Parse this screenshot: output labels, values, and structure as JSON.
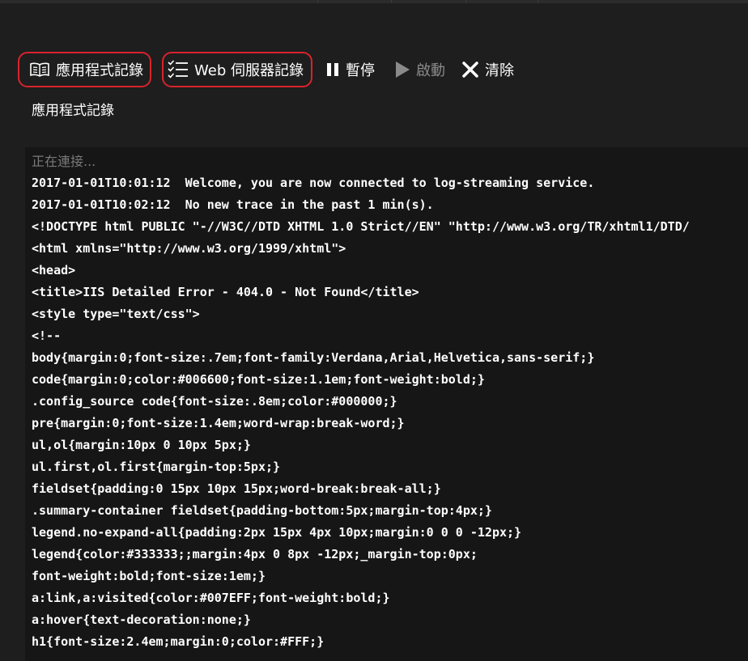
{
  "toolbar": {
    "app_logs_label": "應用程式記錄",
    "web_server_logs_label": "Web 伺服器記錄",
    "pause_label": "暫停",
    "start_label": "啟動",
    "clear_label": "清除"
  },
  "icons": {
    "app_logs": "book-icon",
    "web_server_logs": "checklist-icon",
    "pause": "pause-icon",
    "start": "play-icon",
    "clear": "close-icon"
  },
  "colors": {
    "highlight_border": "#d9232b",
    "background": "#1e1e1e",
    "log_background": "#161616",
    "disabled_text": "#8a8a8a",
    "status_text": "#7a7a7a"
  },
  "section_title": "應用程式記錄",
  "log": {
    "status": "正在連接...",
    "lines": [
      "2017-01-01T10:01:12  Welcome, you are now connected to log-streaming service.",
      "2017-01-01T10:02:12  No new trace in the past 1 min(s).",
      "<!DOCTYPE html PUBLIC \"-//W3C//DTD XHTML 1.0 Strict//EN\" \"http://www.w3.org/TR/xhtml1/DTD/",
      "<html xmlns=\"http://www.w3.org/1999/xhtml\">",
      "<head>",
      "<title>IIS Detailed Error - 404.0 - Not Found</title>",
      "<style type=\"text/css\">",
      "<!--",
      "body{margin:0;font-size:.7em;font-family:Verdana,Arial,Helvetica,sans-serif;}",
      "code{margin:0;color:#006600;font-size:1.1em;font-weight:bold;}",
      ".config_source code{font-size:.8em;color:#000000;}",
      "pre{margin:0;font-size:1.4em;word-wrap:break-word;}",
      "ul,ol{margin:10px 0 10px 5px;}",
      "ul.first,ol.first{margin-top:5px;}",
      "fieldset{padding:0 15px 10px 15px;word-break:break-all;}",
      ".summary-container fieldset{padding-bottom:5px;margin-top:4px;}",
      "legend.no-expand-all{padding:2px 15px 4px 10px;margin:0 0 0 -12px;}",
      "legend{color:#333333;;margin:4px 0 8px -12px;_margin-top:0px;",
      "font-weight:bold;font-size:1em;}",
      "a:link,a:visited{color:#007EFF;font-weight:bold;}",
      "a:hover{text-decoration:none;}",
      "h1{font-size:2.4em;margin:0;color:#FFF;}"
    ]
  }
}
